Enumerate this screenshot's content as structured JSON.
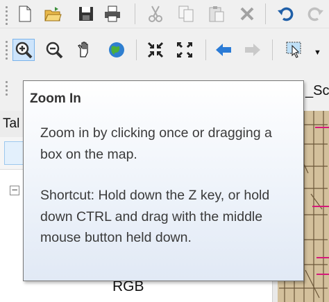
{
  "tooltip": {
    "title": "Zoom In",
    "description": "Zoom in by clicking once or dragging a box on the map.",
    "shortcut": "Shortcut: Hold down the Z key, or hold down CTRL and drag with the middle mouse button held down."
  },
  "panel": {
    "tab_label": "Tal",
    "layer_label": "RGB"
  },
  "map": {
    "title_fragment": "_Sc"
  },
  "colors": {
    "active_button": "#cde4fb",
    "map_background": "#d8c7a8",
    "tooltip_border": "#767676"
  },
  "toolbar": {
    "standard": [
      "new-document-icon",
      "open-folder-icon",
      "save-icon",
      "print-icon",
      "cut-icon",
      "copy-icon",
      "paste-icon",
      "delete-icon",
      "undo-icon",
      "redo-icon"
    ],
    "tools": [
      "zoom-in-icon",
      "zoom-out-icon",
      "pan-icon",
      "full-extent-icon",
      "fixed-zoom-in-icon",
      "fixed-zoom-out-icon",
      "back-extent-icon",
      "forward-extent-icon",
      "select-features-icon"
    ]
  }
}
